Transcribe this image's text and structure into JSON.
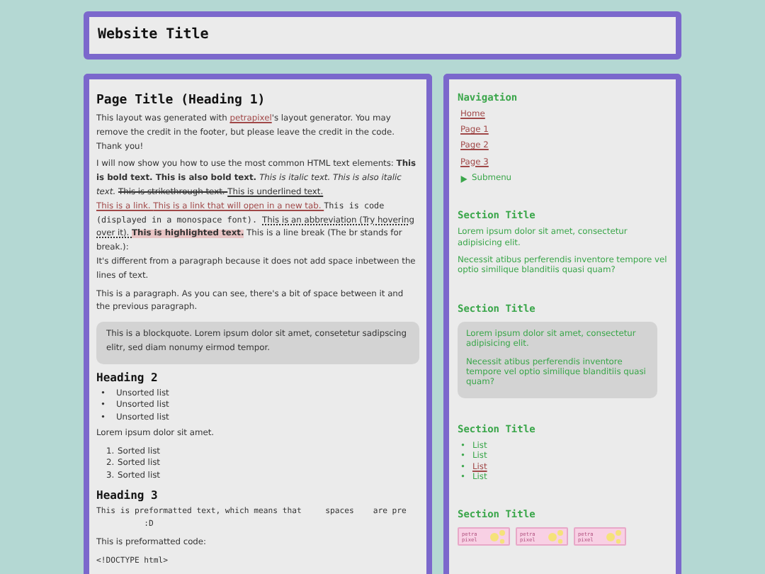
{
  "header": {
    "title": "Website Title"
  },
  "main": {
    "blocks": [
      {
        "kind": "h1",
        "text": "Page Title (Heading 1)"
      },
      {
        "kind": "p",
        "segments": [
          {
            "kind": "plain",
            "text": "This layout was generated with "
          },
          {
            "kind": "link",
            "text": "petrapixel"
          },
          {
            "kind": "plain",
            "text": "'s layout generator. You may remove the credit in the footer, but please leave the credit in the code. Thank you!"
          }
        ]
      },
      {
        "kind": "p",
        "segments": [
          {
            "kind": "plain",
            "text": "I will now show you how to use the most common HTML text elements: "
          },
          {
            "kind": "bold",
            "text": "This is bold text. This is also bold text. "
          },
          {
            "kind": "italic",
            "text": "This is italic text. This is also italic text. "
          },
          {
            "kind": "strike",
            "text": "This is strikethrough text. "
          },
          {
            "kind": "underline",
            "text": "This is underlined text. "
          },
          {
            "kind": "link",
            "text": "This is a link. "
          },
          {
            "kind": "link",
            "text": "This is a link that will open in a new tab. "
          },
          {
            "kind": "code",
            "text": "This is code (displayed in a monospace font). "
          },
          {
            "kind": "abbr",
            "text": "This is an abbreviation (Try hovering over it). "
          },
          {
            "kind": "mark",
            "text": "This is highlighted text."
          },
          {
            "kind": "plain",
            "text": " This is a line break (The br stands for break.):"
          },
          {
            "kind": "break"
          },
          {
            "kind": "plain",
            "text": "It's different from a paragraph because it does not add space inbetween the lines of text."
          }
        ]
      },
      {
        "kind": "p",
        "segments": [
          {
            "kind": "plain",
            "text": "This is a paragraph. As you can see, there's a bit of space between it and the previous paragraph."
          }
        ]
      },
      {
        "kind": "blockquote",
        "text": "This is a blockquote. Lorem ipsum dolor sit amet, consetetur sadipscing elitr, sed diam nonumy eirmod tempor."
      },
      {
        "kind": "h2",
        "text": "Heading 2"
      },
      {
        "kind": "ul",
        "items": [
          {
            "marker": "•",
            "text": "Unsorted list"
          },
          {
            "marker": "•",
            "text": "Unsorted list"
          },
          {
            "marker": "•",
            "text": "Unsorted list"
          }
        ]
      },
      {
        "kind": "p",
        "segments": [
          {
            "kind": "plain",
            "text": "Lorem ipsum dolor sit amet."
          }
        ]
      },
      {
        "kind": "ol",
        "items": [
          {
            "marker": "1.",
            "text": "Sorted list"
          },
          {
            "marker": "2.",
            "text": "Sorted list"
          },
          {
            "marker": "3.",
            "text": "Sorted list"
          }
        ]
      },
      {
        "kind": "h3",
        "text": "Heading 3"
      },
      {
        "kind": "pre",
        "lines": [
          "This is preformatted text, which means that     spaces    are pre",
          "          :D"
        ]
      },
      {
        "kind": "p",
        "segments": [
          {
            "kind": "plain",
            "text": "This is preformatted code:"
          }
        ]
      },
      {
        "kind": "pre",
        "lines": [
          "<!DOCTYPE html>"
        ]
      }
    ]
  },
  "sidebar": {
    "sections": [
      {
        "kind": "nav",
        "title": "Navigation",
        "links": [
          "Home",
          "Page 1",
          "Page 2",
          "Page 3"
        ],
        "submenu": {
          "text": "Submenu",
          "expanded": false
        }
      },
      {
        "kind": "text",
        "title": "Section Title",
        "paragraphs": [
          "Lorem ipsum dolor sit amet, consectetur adipisicing elit.",
          "Necessit atibus perferendis inventore tempore vel optio similique blanditiis quasi quam?"
        ]
      },
      {
        "kind": "boxed",
        "title": "Section Title",
        "paragraphs": [
          "Lorem ipsum dolor sit amet, consectetur adipisicing elit.",
          "Necessit atibus perferendis inventore tempore vel optio similique blanditiis quasi quam?"
        ]
      },
      {
        "kind": "list",
        "title": "Section Title",
        "items": [
          {
            "kind": "plain",
            "marker": "•",
            "text": "List"
          },
          {
            "kind": "plain",
            "marker": "•",
            "text": "List"
          },
          {
            "kind": "link",
            "marker": "•",
            "text": "List"
          },
          {
            "kind": "plain",
            "marker": "•",
            "text": "List"
          }
        ]
      },
      {
        "kind": "badges",
        "title": "Section Title",
        "badges": [
          {
            "lines": [
              "petra",
              "pixel"
            ]
          },
          {
            "lines": [
              "petra",
              "pixel"
            ]
          },
          {
            "lines": [
              "petra",
              "pixel"
            ]
          }
        ]
      }
    ]
  }
}
